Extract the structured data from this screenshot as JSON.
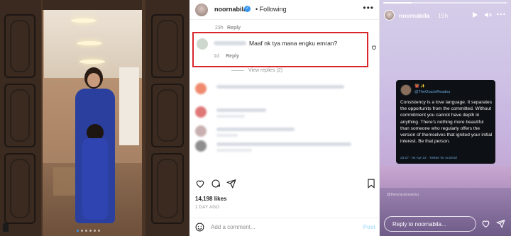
{
  "post": {
    "username": "noornabila",
    "verified_mark": "✓",
    "follow_label": "Following",
    "more_label": "•••",
    "prev_comment_time": "23h",
    "prev_comment_reply": "Reply",
    "highlight_comment": {
      "text": "Maaf nk tya mana engku emran?",
      "time": "1d",
      "reply": "Reply"
    },
    "view_replies": "View replies (2)",
    "likes": "14,198 likes",
    "ago": "1 DAY AGO",
    "add_comment_placeholder": "Add a comment...",
    "post_label": "Post",
    "photo_dots": 6
  },
  "story": {
    "username": "noornabila",
    "time": "15h",
    "tweet": {
      "name": "👹 ✨",
      "handle": "@TheOracleReadsu",
      "body": "Consistency is a love language. It separates the opportunits from the committed. Without commitment you cannot have depth in anything. There's nothing more beautiful than someone who regularly offers the version of themselves that ignited your initial interest. Be that person.",
      "footer": "23:27 · 04 Apr 22 · Twitter for Android"
    },
    "watermark": "@theoraclereadsu",
    "reply_placeholder": "Reply to noornabila..."
  },
  "colors": {
    "highlight": "#d9262b",
    "verified": "#3897f0",
    "tweet_bg": "#0d1014"
  },
  "icons": [
    "heart-icon",
    "comment-icon",
    "share-icon",
    "bookmark-icon",
    "emoji-icon",
    "play-icon",
    "mute-icon",
    "more-icon",
    "send-icon"
  ]
}
